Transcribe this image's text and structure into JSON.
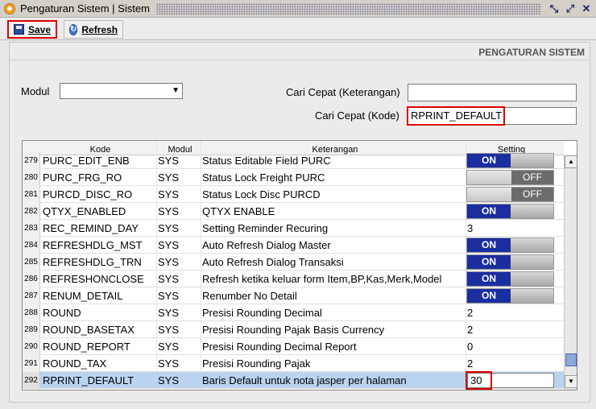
{
  "window": {
    "title": "Pengaturan Sistem | Sistem"
  },
  "toolbar": {
    "save_label": "Save",
    "refresh_label": "Refresh"
  },
  "section": {
    "title": "PENGATURAN SISTEM"
  },
  "form": {
    "modul_label": "Modul",
    "modul_value": "",
    "cari_ket_label": "Cari Cepat (Keterangan)",
    "cari_ket_value": "",
    "cari_kode_label": "Cari Cepat (Kode)",
    "cari_kode_value": "RPRINT_DEFAULT"
  },
  "grid": {
    "headers": {
      "kode": "Kode",
      "modul": "Modul",
      "keterangan": "Keterangan",
      "setting": "Setting"
    },
    "rows": [
      {
        "num": "279",
        "kode": "PURC_EDIT_ENB",
        "modul": "SYS",
        "ket": "Status Editable Field PURC",
        "setting": "ON",
        "type": "on"
      },
      {
        "num": "280",
        "kode": "PURC_FRG_RO",
        "modul": "SYS",
        "ket": "Status Lock Freight PURC",
        "setting": "OFF",
        "type": "off"
      },
      {
        "num": "281",
        "kode": "PURCD_DISC_RO",
        "modul": "SYS",
        "ket": "Status Lock Disc PURCD",
        "setting": "OFF",
        "type": "off"
      },
      {
        "num": "282",
        "kode": "QTYX_ENABLED",
        "modul": "SYS",
        "ket": "QTYX ENABLE",
        "setting": "ON",
        "type": "on"
      },
      {
        "num": "283",
        "kode": "REC_REMIND_DAY",
        "modul": "SYS",
        "ket": "Setting Reminder Recuring",
        "setting": "3",
        "type": "text"
      },
      {
        "num": "284",
        "kode": "REFRESHDLG_MST",
        "modul": "SYS",
        "ket": "Auto Refresh Dialog Master",
        "setting": "ON",
        "type": "on"
      },
      {
        "num": "285",
        "kode": "REFRESHDLG_TRN",
        "modul": "SYS",
        "ket": "Auto Refresh Dialog Transaksi",
        "setting": "ON",
        "type": "on"
      },
      {
        "num": "286",
        "kode": "REFRESHONCLOSE",
        "modul": "SYS",
        "ket": "Refresh ketika keluar form Item,BP,Kas,Merk,Model",
        "setting": "ON",
        "type": "on"
      },
      {
        "num": "287",
        "kode": "RENUM_DETAIL",
        "modul": "SYS",
        "ket": "Renumber No Detail",
        "setting": "ON",
        "type": "on"
      },
      {
        "num": "288",
        "kode": "ROUND",
        "modul": "SYS",
        "ket": "Presisi Rounding Decimal",
        "setting": "2",
        "type": "text"
      },
      {
        "num": "289",
        "kode": "ROUND_BASETAX",
        "modul": "SYS",
        "ket": "Presisi Rounding Pajak Basis Currency",
        "setting": "2",
        "type": "text"
      },
      {
        "num": "290",
        "kode": "ROUND_REPORT",
        "modul": "SYS",
        "ket": "Presisi Rounding Decimal Report",
        "setting": "0",
        "type": "text"
      },
      {
        "num": "291",
        "kode": "ROUND_TAX",
        "modul": "SYS",
        "ket": "Presisi Rounding Pajak",
        "setting": "2",
        "type": "text"
      },
      {
        "num": "292",
        "kode": "RPRINT_DEFAULT",
        "modul": "SYS",
        "ket": "Baris Default untuk nota jasper per halaman",
        "setting": "30",
        "type": "edit"
      }
    ]
  }
}
